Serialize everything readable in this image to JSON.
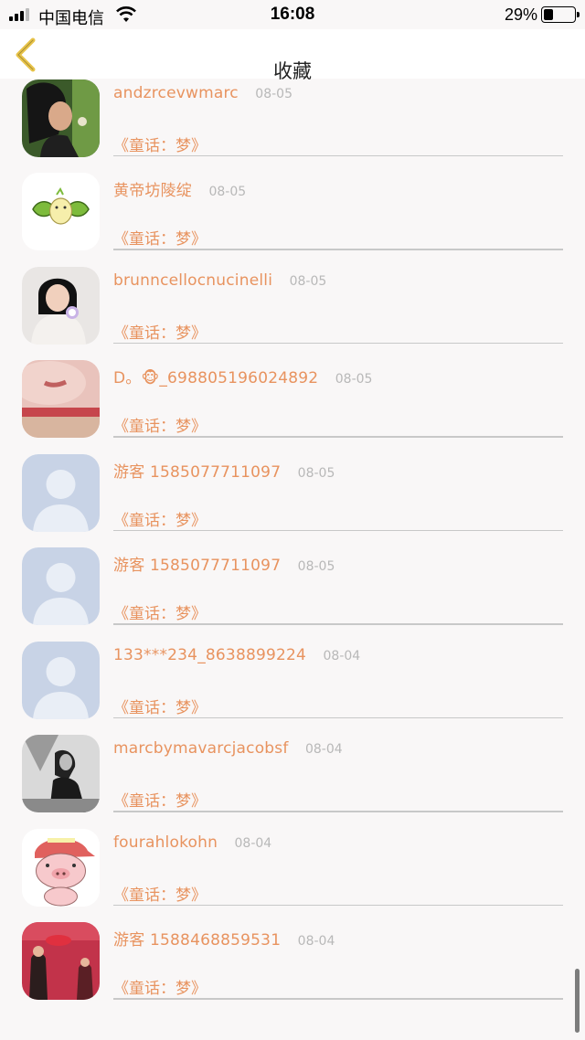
{
  "status_bar": {
    "carrier": "中国电信",
    "time": "16:08",
    "battery_percent": "29%",
    "battery_level": 0.29
  },
  "nav": {
    "title": "收藏",
    "back_icon": "chevron-left-icon",
    "accent_color": "#e8c44a"
  },
  "colors": {
    "name": "#e8935f",
    "date": "#b8b8b8",
    "divider": "#c8c8c8"
  },
  "items": [
    {
      "name": "",
      "date": "",
      "content": "《童话：梦》",
      "avatar": "sticker"
    },
    {
      "name": "andzrcevwmarc",
      "date": "08-05",
      "content": "《童话：梦》",
      "avatar": "woman-photo"
    },
    {
      "name": "黄帝坊陵绽",
      "date": "08-05",
      "content": "《童话：梦》",
      "avatar": "bird-leaves"
    },
    {
      "name": "brunncellocnucinelli",
      "date": "08-05",
      "content": "《童话：梦》",
      "avatar": "child-photo"
    },
    {
      "name": "D。🐵_698805196024892",
      "date": "08-05",
      "content": "《童话：梦》",
      "avatar": "closeup-photo"
    },
    {
      "name": "游客 1585077711097",
      "date": "08-05",
      "content": "《童话：梦》",
      "avatar": "default-user"
    },
    {
      "name": "游客 1585077711097",
      "date": "08-05",
      "content": "《童话：梦》",
      "avatar": "default-user"
    },
    {
      "name": "133***234_8638899224",
      "date": "08-04",
      "content": "《童话：梦》",
      "avatar": "default-user"
    },
    {
      "name": "marcbymavarcjacobsf",
      "date": "08-04",
      "content": "《童话：梦》",
      "avatar": "bw-photo"
    },
    {
      "name": "fourahlokohn",
      "date": "08-04",
      "content": "《童话：梦》",
      "avatar": "pig-cartoon"
    },
    {
      "name": "游客 1588468859531",
      "date": "08-04",
      "content": "《童话：梦》",
      "avatar": "red-photo"
    }
  ]
}
